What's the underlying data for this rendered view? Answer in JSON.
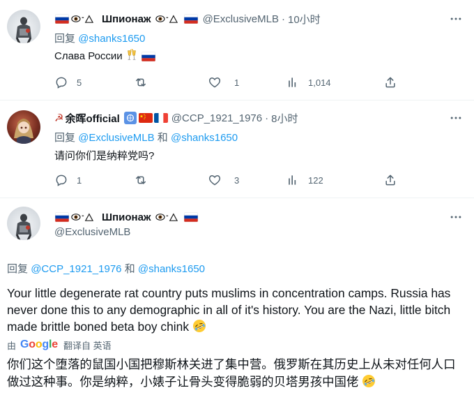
{
  "tweets": [
    {
      "name": "Шпионаж",
      "handle": "@ExclusiveMLB",
      "time": "10小时",
      "reply_prefix": "回复",
      "reply_to": "@shanks1650",
      "text": "Слава России",
      "replies": "5",
      "retweets": "",
      "likes": "1",
      "views": "1,014"
    },
    {
      "name": "余晖official",
      "handle": "@CCP_1921_1976",
      "time": "8小时",
      "reply_prefix": "回复",
      "reply_to_1": "@ExclusiveMLB",
      "reply_and": "和",
      "reply_to_2": "@shanks1650",
      "text": "请问你们是纳粹党吗?",
      "replies": "1",
      "retweets": "",
      "likes": "3",
      "views": "122"
    },
    {
      "name": "Шпионаж",
      "handle": "@ExclusiveMLB",
      "reply_prefix": "回复",
      "reply_to_1": "@CCP_1921_1976",
      "reply_and": "和",
      "reply_to_2": "@shanks1650",
      "text": "Your little degenerate rat country puts muslims in concentration camps. Russia has never done this to any demographic in all of it's history. You are the Nazi, little bitch made brittle boned beta boy chink",
      "translate_by": "由",
      "translate_label": "翻译自 英语",
      "translation": "你们这个堕落的鼠国小国把穆斯林关进了集中营。俄罗斯在其历史上从未对任何人口做过这种事。你是纳粹，小婊子让骨头变得脆弱的贝塔男孩中国佬"
    }
  ],
  "icons": {
    "reply": "reply-icon",
    "retweet": "retweet-icon",
    "like": "heart-icon",
    "views": "views-icon",
    "share": "share-icon",
    "more": "more-icon",
    "laughing": "rolling-laughing-emoji"
  },
  "colors": {
    "text": "#0f1419",
    "secondary": "#536471",
    "link": "#1d9bf0",
    "divider": "#eff3f4"
  }
}
